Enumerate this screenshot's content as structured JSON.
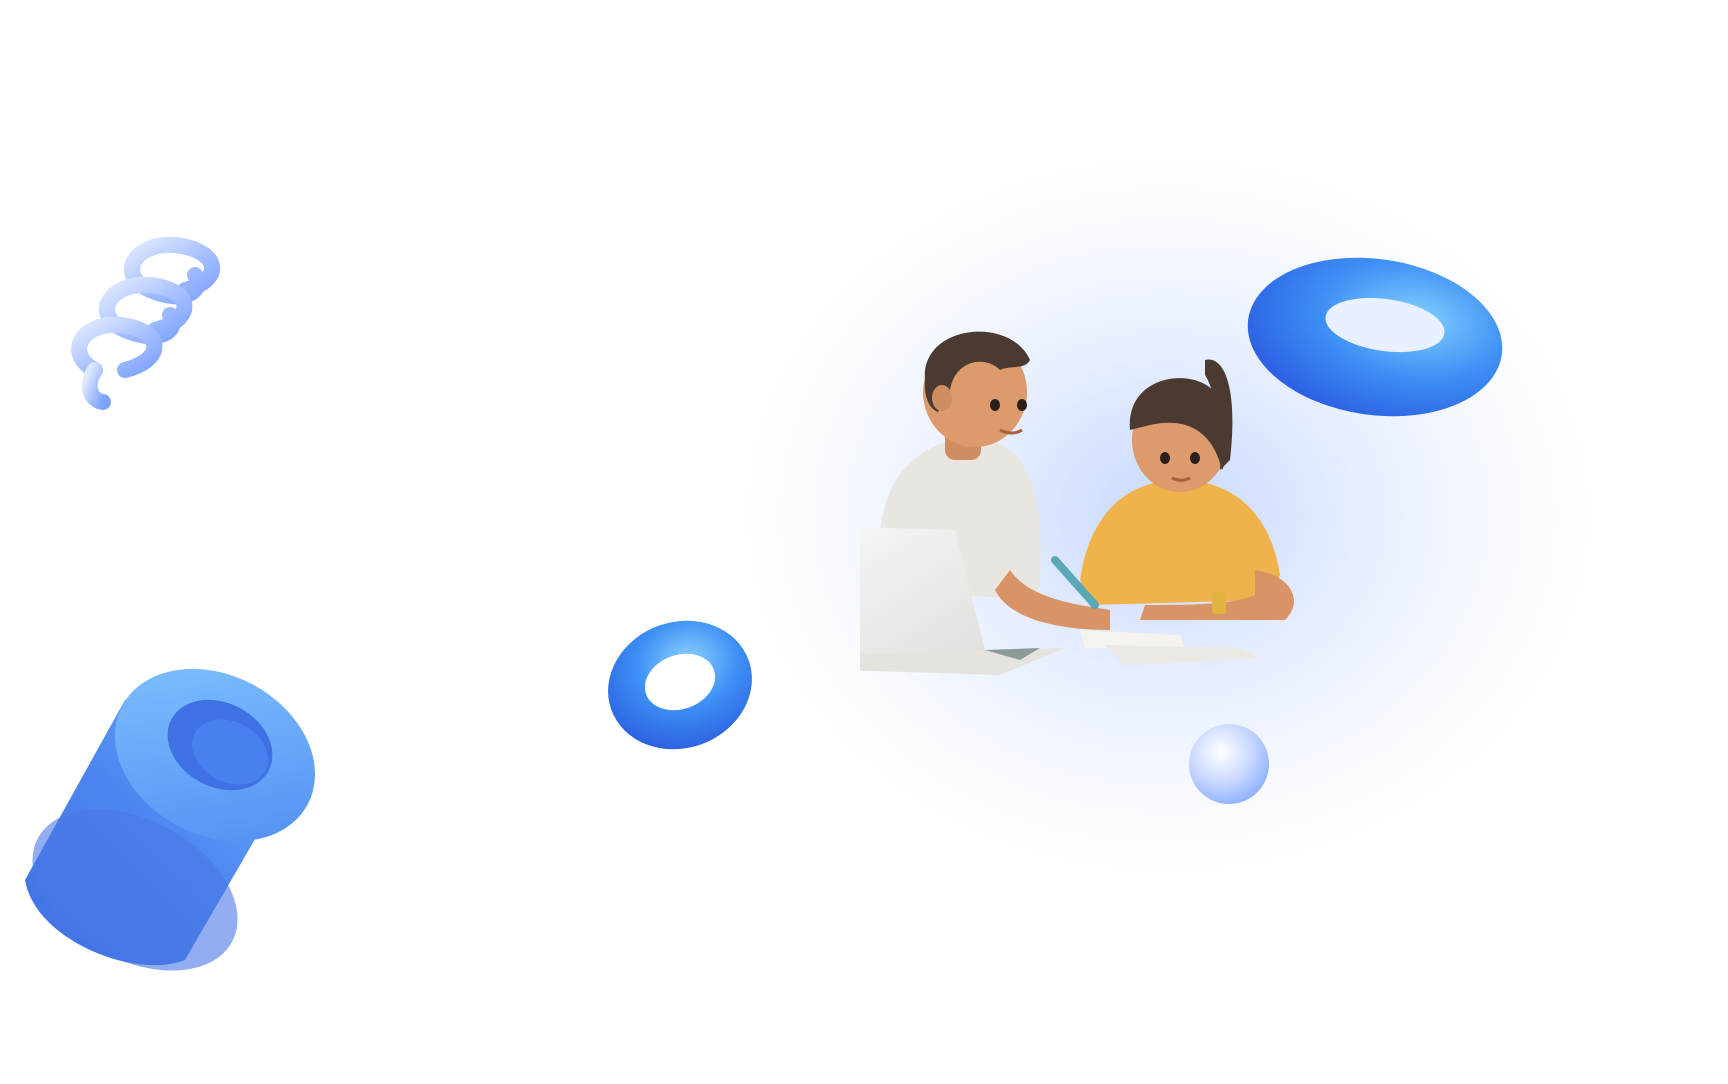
{
  "scene": {
    "icons": [
      "spring-coil-icon",
      "cylinder-tube-icon",
      "torus-ring-icon",
      "torus-ring-large-icon",
      "sphere-icon",
      "laptop-icon"
    ],
    "colors": {
      "background": "#ffffff",
      "glow": "#d3e0ff",
      "accent_blue": "#3b82f6",
      "light_blue": "#a9c4ff",
      "skin": "#d9956b",
      "hair": "#4a3a33",
      "shirt_white": "#e8e4e0",
      "shirt_yellow": "#f0b44c",
      "laptop": "#efeeec"
    }
  }
}
